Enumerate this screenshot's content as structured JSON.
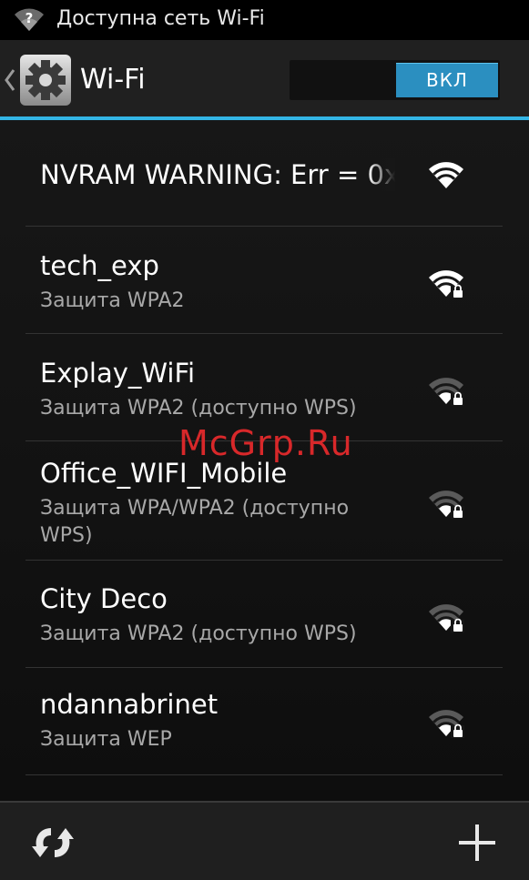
{
  "status_bar": {
    "notification_text": "Доступна сеть Wi-Fi",
    "icon": "wifi-notification-icon"
  },
  "action_bar": {
    "title": "Wi-Fi",
    "icon": "settings-gear-icon",
    "switch_label": "ВКЛ",
    "switch_state": "on",
    "accent_color": "#33b5e5"
  },
  "networks": [
    {
      "ssid": "NVRAM WARNING: Err = 0x",
      "security": "",
      "secured": false,
      "signal_level": 4
    },
    {
      "ssid": "tech_exp",
      "security": "Защита WPA2",
      "secured": true,
      "signal_level": 4
    },
    {
      "ssid": "Explay_WiFi",
      "security": "Защита WPA2 (доступно WPS)",
      "secured": true,
      "signal_level": 1
    },
    {
      "ssid": "Office_WIFI_Mobile",
      "security": "Защита WPA/WPA2 (доступно WPS)",
      "secured": true,
      "signal_level": 1
    },
    {
      "ssid": "City Deco",
      "security": "Защита WPA2 (доступно WPS)",
      "secured": true,
      "signal_level": 1
    },
    {
      "ssid": "ndannabrinet",
      "security": "Защита WEP",
      "secured": true,
      "signal_level": 1
    }
  ],
  "bottom_bar": {
    "scan_icon": "scan-refresh-icon",
    "add_icon": "add-network-icon"
  },
  "watermark": "McGrp.Ru"
}
